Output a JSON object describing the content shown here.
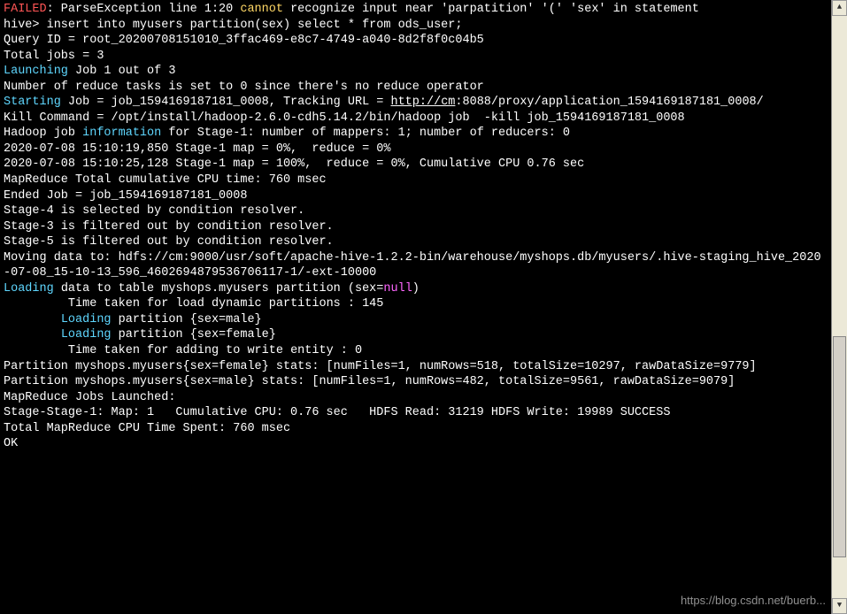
{
  "lines": [
    {
      "segs": [
        {
          "t": "FAILED",
          "c": "kw-red"
        },
        {
          "t": ": ParseException line 1:20 "
        },
        {
          "t": "cannot",
          "c": "kw-yellow"
        },
        {
          "t": " recognize input near 'parpatition' '(' 'sex' in statement"
        }
      ]
    },
    {
      "segs": [
        {
          "t": "hive> insert into myusers partition(sex) select * from ods_user;"
        }
      ]
    },
    {
      "segs": [
        {
          "t": "Query ID = root_20200708151010_3ffac469-e8c7-4749-a040-8d2f8f0c04b5"
        }
      ]
    },
    {
      "segs": [
        {
          "t": "Total jobs = 3"
        }
      ]
    },
    {
      "segs": [
        {
          "t": "Launching",
          "c": "kw-cyan"
        },
        {
          "t": " Job 1 out of 3"
        }
      ]
    },
    {
      "segs": [
        {
          "t": "Number of reduce tasks is set to 0 since there's no reduce operator"
        }
      ]
    },
    {
      "segs": [
        {
          "t": "Starting",
          "c": "kw-cyan"
        },
        {
          "t": " Job = job_1594169187181_0008, Tracking URL = "
        },
        {
          "t": "http://cm",
          "c": "kw-url"
        },
        {
          "t": ":8088/proxy/application_1594169187181_0008/"
        }
      ]
    },
    {
      "segs": [
        {
          "t": "Kill Command = /opt/install/hadoop-2.6.0-cdh5.14.2/bin/hadoop job  -kill job_1594169187181_0008"
        }
      ]
    },
    {
      "segs": [
        {
          "t": "Hadoop job "
        },
        {
          "t": "information",
          "c": "kw-cyan"
        },
        {
          "t": " for Stage-1: number of mappers: 1; number of reducers: 0"
        }
      ]
    },
    {
      "segs": [
        {
          "t": "2020-07-08 15:10:19,850 Stage-1 map = 0%,  reduce = 0%"
        }
      ]
    },
    {
      "segs": [
        {
          "t": "2020-07-08 15:10:25,128 Stage-1 map = 100%,  reduce = 0%, Cumulative CPU 0.76 sec"
        }
      ]
    },
    {
      "segs": [
        {
          "t": "MapReduce Total cumulative CPU time: 760 msec"
        }
      ]
    },
    {
      "segs": [
        {
          "t": "Ended Job = job_1594169187181_0008"
        }
      ]
    },
    {
      "segs": [
        {
          "t": "Stage-4 is selected by condition resolver."
        }
      ]
    },
    {
      "segs": [
        {
          "t": "Stage-3 is filtered out by condition resolver."
        }
      ]
    },
    {
      "segs": [
        {
          "t": "Stage-5 is filtered out by condition resolver."
        }
      ]
    },
    {
      "segs": [
        {
          "t": "Moving data to: hdfs://cm:9000/usr/soft/apache-hive-1.2.2-bin/warehouse/myshops.db/myusers/.hive-staging_hive_2020-07-08_15-10-13_596_4602694879536706117-1/-ext-10000"
        }
      ]
    },
    {
      "segs": [
        {
          "t": "Loading",
          "c": "kw-cyan"
        },
        {
          "t": " data to table myshops.myusers partition (sex="
        },
        {
          "t": "null",
          "c": "kw-magenta"
        },
        {
          "t": ")"
        }
      ]
    },
    {
      "segs": [
        {
          "t": "         Time taken for load dynamic partitions : 145"
        }
      ]
    },
    {
      "segs": [
        {
          "t": "        "
        },
        {
          "t": "Loading",
          "c": "kw-cyan"
        },
        {
          "t": " partition {sex=male}"
        }
      ]
    },
    {
      "segs": [
        {
          "t": "        "
        },
        {
          "t": "Loading",
          "c": "kw-cyan"
        },
        {
          "t": " partition {sex=female}"
        }
      ]
    },
    {
      "segs": [
        {
          "t": "         Time taken for adding to write entity : 0"
        }
      ]
    },
    {
      "segs": [
        {
          "t": "Partition myshops.myusers{sex=female} stats: [numFiles=1, numRows=518, totalSize=10297, rawDataSize=9779]"
        }
      ]
    },
    {
      "segs": [
        {
          "t": "Partition myshops.myusers{sex=male} stats: [numFiles=1, numRows=482, totalSize=9561, rawDataSize=9079]"
        }
      ]
    },
    {
      "segs": [
        {
          "t": "MapReduce Jobs Launched:"
        }
      ]
    },
    {
      "segs": [
        {
          "t": "Stage-Stage-1: Map: 1   Cumulative CPU: 0.76 sec   HDFS Read: 31219 HDFS Write: 19989 SUCCESS"
        }
      ]
    },
    {
      "segs": [
        {
          "t": "Total MapReduce CPU Time Spent: 760 msec"
        }
      ]
    },
    {
      "segs": [
        {
          "t": "OK"
        }
      ]
    }
  ],
  "scroll": {
    "up": "▲",
    "down": "▼"
  },
  "watermark": "https://blog.csdn.net/buerb..."
}
